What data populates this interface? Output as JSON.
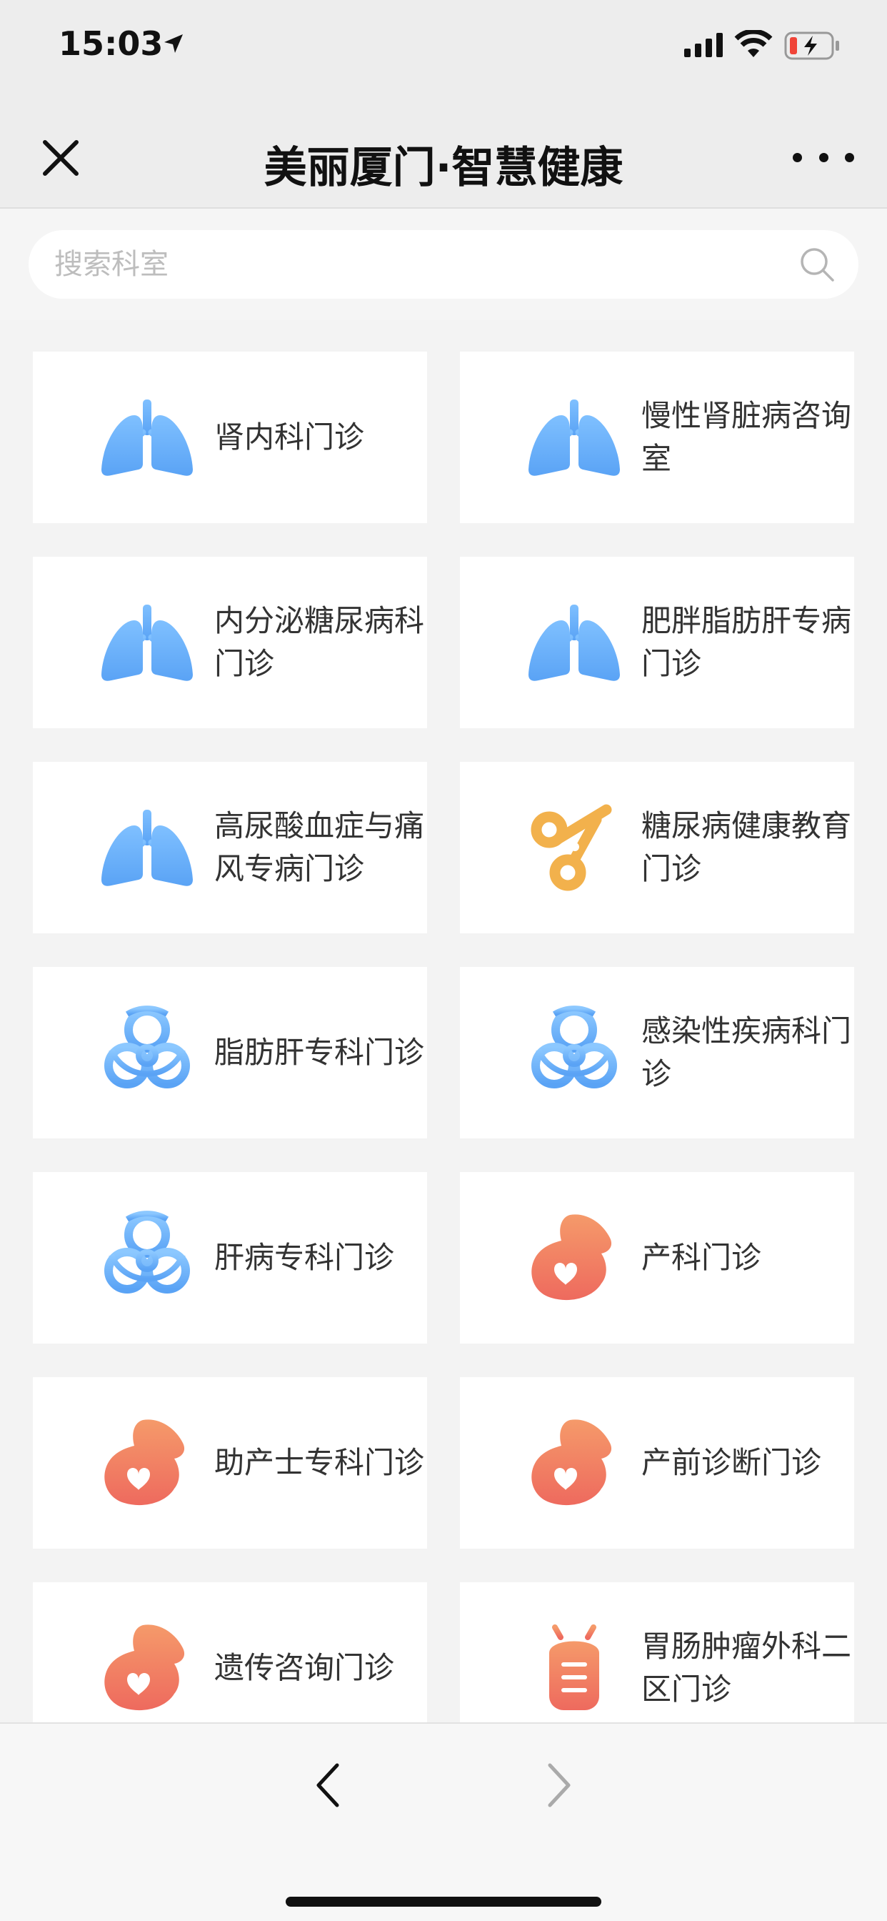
{
  "status_bar": {
    "time": "15:03"
  },
  "nav": {
    "title": "美丽厦门·智慧健康"
  },
  "search": {
    "placeholder": "搜索科室"
  },
  "departments": [
    {
      "label": "肾内科门诊",
      "icon": "lungs-icon"
    },
    {
      "label": "慢性肾脏病咨询室",
      "icon": "lungs-icon"
    },
    {
      "label": "内分泌糖尿病科门诊",
      "icon": "lungs-icon"
    },
    {
      "label": "肥胖脂肪肝专病门诊",
      "icon": "lungs-icon"
    },
    {
      "label": "高尿酸血症与痛风专病门诊",
      "icon": "lungs-icon"
    },
    {
      "label": "糖尿病健康教育门诊",
      "icon": "scissors-icon"
    },
    {
      "label": "脂肪肝专科门诊",
      "icon": "biohazard-icon"
    },
    {
      "label": "感染性疾病科门诊",
      "icon": "biohazard-icon"
    },
    {
      "label": "肝病专科门诊",
      "icon": "biohazard-icon"
    },
    {
      "label": "产科门诊",
      "icon": "pregnancy-icon"
    },
    {
      "label": "助产士专科门诊",
      "icon": "pregnancy-icon"
    },
    {
      "label": "产前诊断门诊",
      "icon": "pregnancy-icon"
    },
    {
      "label": "遗传咨询门诊",
      "icon": "pregnancy-icon"
    },
    {
      "label": "胃肠肿瘤外科二区门诊",
      "icon": "bug-icon"
    }
  ],
  "colors": {
    "lungs": "#5aa3f5",
    "scissors": "#f2b14c",
    "biohazard": "#5aa3f5",
    "pregnancy": "#ee6a5e",
    "bug": "#ee6a5e"
  }
}
